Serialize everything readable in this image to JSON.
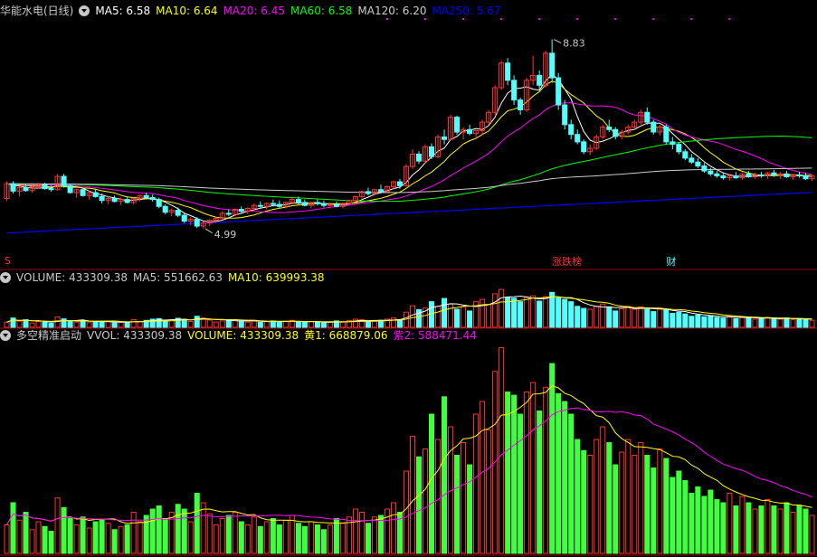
{
  "colors": {
    "up": "#ff3232",
    "down": "#54ffff",
    "ma5": "#ffffff",
    "ma10": "#ffff00",
    "ma20": "#ff00ff",
    "ma60": "#00ff00",
    "ma120": "#cccccc",
    "ma250": "#0000ff",
    "vol_up": "#ff3232",
    "vol_down": "#3fff3f",
    "divider": "#a00000",
    "text": "#c8c8c8"
  },
  "price_panel": {
    "title": "华能水电(日线)",
    "ma_labels": [
      {
        "key": "ma5",
        "text": "MA5: 6.58"
      },
      {
        "key": "ma10",
        "text": "MA10: 6.64"
      },
      {
        "key": "ma20",
        "text": "MA20: 6.45"
      },
      {
        "key": "ma60",
        "text": "MA60: 6.58"
      },
      {
        "key": "ma120",
        "text": "MA120: 6.20"
      },
      {
        "key": "ma250",
        "text": "MA250: 5.67"
      }
    ],
    "high_label": "8.83",
    "low_label": "4.99",
    "markers": [
      {
        "text": "涨跌榜",
        "color": "#ff3232",
        "index": 87
      },
      {
        "text": "财",
        "color": "#54ffff",
        "index": 105
      }
    ],
    "left_marker": "S"
  },
  "volume_panel": {
    "labels": [
      {
        "color": "#c8c8c8",
        "text": "VOLUME: 433309.38"
      },
      {
        "color": "#c8c8c8",
        "text": "MA5: 551662.63"
      },
      {
        "color": "#ffff00",
        "text": "MA10: 639993.38"
      }
    ]
  },
  "indicator_panel": {
    "labels": [
      {
        "color": "#c8c8c8",
        "text": "多空精准启动"
      },
      {
        "color": "#c8c8c8",
        "text": "VVOL: 433309.38"
      },
      {
        "color": "#ffff00",
        "text": "VOLUME: 433309.38"
      },
      {
        "color": "#ffff00",
        "text": "黄1: 668879.06"
      },
      {
        "color": "#ff00ff",
        "text": "紫2: 588471.44"
      }
    ]
  },
  "chart_data": {
    "type": "candlestick",
    "price_range": [
      4.6,
      9.3
    ],
    "ohlc": [
      [
        5.6,
        5.95,
        5.55,
        5.9
      ],
      [
        5.9,
        5.95,
        5.7,
        5.75
      ],
      [
        5.75,
        5.85,
        5.65,
        5.82
      ],
      [
        5.82,
        5.9,
        5.74,
        5.76
      ],
      [
        5.76,
        5.86,
        5.72,
        5.84
      ],
      [
        5.84,
        5.92,
        5.8,
        5.88
      ],
      [
        5.88,
        5.92,
        5.78,
        5.8
      ],
      [
        5.8,
        5.86,
        5.74,
        5.78
      ],
      [
        5.78,
        6.1,
        5.76,
        6.05
      ],
      [
        6.05,
        6.1,
        5.82,
        5.86
      ],
      [
        5.86,
        5.9,
        5.7,
        5.72
      ],
      [
        5.72,
        5.8,
        5.62,
        5.78
      ],
      [
        5.78,
        5.82,
        5.64,
        5.66
      ],
      [
        5.66,
        5.75,
        5.58,
        5.72
      ],
      [
        5.72,
        5.8,
        5.62,
        5.64
      ],
      [
        5.64,
        5.7,
        5.5,
        5.56
      ],
      [
        5.56,
        5.64,
        5.48,
        5.6
      ],
      [
        5.6,
        5.66,
        5.52,
        5.54
      ],
      [
        5.54,
        5.62,
        5.46,
        5.58
      ],
      [
        5.58,
        5.64,
        5.5,
        5.52
      ],
      [
        5.52,
        5.62,
        5.48,
        5.6
      ],
      [
        5.6,
        5.68,
        5.54,
        5.66
      ],
      [
        5.66,
        5.72,
        5.58,
        5.62
      ],
      [
        5.62,
        5.68,
        5.54,
        5.58
      ],
      [
        5.58,
        5.62,
        5.4,
        5.44
      ],
      [
        5.44,
        5.48,
        5.28,
        5.32
      ],
      [
        5.32,
        5.4,
        5.24,
        5.36
      ],
      [
        5.36,
        5.42,
        5.22,
        5.26
      ],
      [
        5.26,
        5.3,
        5.1,
        5.14
      ],
      [
        5.14,
        5.22,
        5.06,
        5.18
      ],
      [
        5.18,
        5.22,
        5.0,
        5.04
      ],
      [
        5.04,
        5.14,
        4.99,
        5.1
      ],
      [
        5.1,
        5.18,
        5.04,
        5.16
      ],
      [
        5.16,
        5.24,
        5.1,
        5.2
      ],
      [
        5.2,
        5.34,
        5.16,
        5.3
      ],
      [
        5.3,
        5.38,
        5.24,
        5.28
      ],
      [
        5.28,
        5.4,
        5.24,
        5.38
      ],
      [
        5.38,
        5.44,
        5.3,
        5.34
      ],
      [
        5.34,
        5.42,
        5.28,
        5.4
      ],
      [
        5.4,
        5.5,
        5.34,
        5.46
      ],
      [
        5.46,
        5.54,
        5.4,
        5.44
      ],
      [
        5.44,
        5.52,
        5.38,
        5.5
      ],
      [
        5.5,
        5.58,
        5.44,
        5.48
      ],
      [
        5.48,
        5.56,
        5.4,
        5.44
      ],
      [
        5.44,
        5.54,
        5.4,
        5.52
      ],
      [
        5.52,
        5.62,
        5.48,
        5.58
      ],
      [
        5.58,
        5.64,
        5.48,
        5.52
      ],
      [
        5.52,
        5.58,
        5.44,
        5.46
      ],
      [
        5.46,
        5.54,
        5.4,
        5.52
      ],
      [
        5.52,
        5.58,
        5.46,
        5.5
      ],
      [
        5.5,
        5.56,
        5.42,
        5.46
      ],
      [
        5.46,
        5.52,
        5.4,
        5.48
      ],
      [
        5.48,
        5.54,
        5.42,
        5.44
      ],
      [
        5.44,
        5.52,
        5.4,
        5.5
      ],
      [
        5.5,
        5.58,
        5.46,
        5.56
      ],
      [
        5.56,
        5.66,
        5.52,
        5.64
      ],
      [
        5.64,
        5.76,
        5.6,
        5.74
      ],
      [
        5.74,
        5.82,
        5.66,
        5.7
      ],
      [
        5.7,
        5.8,
        5.66,
        5.78
      ],
      [
        5.78,
        5.88,
        5.7,
        5.74
      ],
      [
        5.74,
        5.86,
        5.7,
        5.84
      ],
      [
        5.84,
        5.96,
        5.78,
        5.94
      ],
      [
        5.94,
        6.0,
        5.8,
        5.86
      ],
      [
        5.86,
        6.3,
        5.84,
        6.25
      ],
      [
        6.25,
        6.6,
        6.2,
        6.5
      ],
      [
        6.5,
        6.56,
        6.3,
        6.36
      ],
      [
        6.36,
        6.7,
        6.32,
        6.65
      ],
      [
        6.65,
        6.72,
        6.4,
        6.45
      ],
      [
        6.45,
        6.9,
        6.42,
        6.85
      ],
      [
        6.85,
        7.0,
        6.7,
        6.8
      ],
      [
        6.8,
        7.3,
        6.78,
        7.25
      ],
      [
        7.25,
        7.28,
        6.9,
        6.95
      ],
      [
        6.95,
        7.05,
        6.8,
        7.0
      ],
      [
        7.0,
        7.1,
        6.88,
        6.92
      ],
      [
        6.92,
        7.0,
        6.8,
        6.98
      ],
      [
        6.98,
        7.2,
        6.9,
        7.15
      ],
      [
        7.15,
        7.4,
        7.1,
        7.35
      ],
      [
        7.35,
        7.9,
        7.3,
        7.85
      ],
      [
        7.85,
        8.4,
        7.8,
        8.35
      ],
      [
        8.35,
        8.45,
        7.9,
        8.0
      ],
      [
        8.0,
        8.1,
        7.5,
        7.6
      ],
      [
        7.6,
        7.65,
        7.3,
        7.4
      ],
      [
        7.4,
        8.05,
        7.36,
        8.0
      ],
      [
        8.0,
        8.5,
        7.9,
        8.1
      ],
      [
        8.1,
        8.2,
        7.8,
        7.9
      ],
      [
        7.9,
        8.6,
        7.85,
        8.55
      ],
      [
        8.55,
        8.83,
        7.95,
        8.05
      ],
      [
        8.05,
        8.15,
        7.4,
        7.5
      ],
      [
        7.5,
        7.6,
        7.0,
        7.1
      ],
      [
        7.1,
        7.2,
        6.8,
        6.9
      ],
      [
        6.9,
        7.0,
        6.7,
        6.75
      ],
      [
        6.75,
        6.8,
        6.5,
        6.55
      ],
      [
        6.55,
        6.7,
        6.48,
        6.62
      ],
      [
        6.62,
        6.9,
        6.58,
        6.85
      ],
      [
        6.85,
        7.1,
        6.8,
        7.05
      ],
      [
        7.05,
        7.2,
        6.95,
        7.0
      ],
      [
        7.0,
        7.05,
        6.8,
        6.86
      ],
      [
        6.86,
        7.0,
        6.8,
        6.95
      ],
      [
        6.95,
        7.1,
        6.9,
        7.05
      ],
      [
        7.05,
        7.2,
        7.0,
        7.15
      ],
      [
        7.15,
        7.4,
        7.1,
        7.35
      ],
      [
        7.35,
        7.45,
        7.1,
        7.15
      ],
      [
        7.15,
        7.2,
        6.9,
        6.95
      ],
      [
        6.95,
        7.1,
        6.88,
        7.05
      ],
      [
        7.05,
        7.1,
        6.7,
        6.75
      ],
      [
        6.75,
        6.85,
        6.6,
        6.7
      ],
      [
        6.7,
        6.75,
        6.5,
        6.55
      ],
      [
        6.55,
        6.6,
        6.38,
        6.42
      ],
      [
        6.42,
        6.5,
        6.3,
        6.34
      ],
      [
        6.34,
        6.42,
        6.22,
        6.26
      ],
      [
        6.26,
        6.32,
        6.12,
        6.16
      ],
      [
        6.16,
        6.22,
        6.06,
        6.1
      ],
      [
        6.1,
        6.16,
        6.02,
        6.06
      ],
      [
        6.06,
        6.12,
        5.98,
        6.02
      ],
      [
        6.02,
        6.1,
        5.96,
        6.06
      ],
      [
        6.06,
        6.14,
        6.0,
        6.02
      ],
      [
        6.02,
        6.12,
        5.98,
        6.1
      ],
      [
        6.1,
        6.16,
        6.02,
        6.04
      ],
      [
        6.04,
        6.12,
        6.0,
        6.08
      ],
      [
        6.08,
        6.14,
        6.02,
        6.06
      ],
      [
        6.06,
        6.14,
        6.0,
        6.12
      ],
      [
        6.12,
        6.18,
        6.04,
        6.08
      ],
      [
        6.08,
        6.14,
        6.0,
        6.1
      ],
      [
        6.1,
        6.16,
        6.02,
        6.04
      ],
      [
        6.04,
        6.1,
        5.98,
        6.08
      ],
      [
        6.08,
        6.14,
        6.02,
        6.06
      ],
      [
        6.06,
        6.12,
        5.98,
        6.0
      ],
      [
        6.0,
        6.08,
        5.96,
        6.06
      ]
    ],
    "volume": [
      180,
      320,
      210,
      260,
      150,
      200,
      170,
      140,
      350,
      290,
      220,
      180,
      230,
      160,
      200,
      210,
      190,
      150,
      170,
      180,
      260,
      200,
      240,
      280,
      300,
      220,
      260,
      310,
      280,
      200,
      380,
      320,
      250,
      180,
      220,
      240,
      260,
      200,
      180,
      230,
      170,
      200,
      220,
      180,
      210,
      240,
      190,
      170,
      200,
      180,
      150,
      180,
      220,
      190,
      230,
      280,
      260,
      190,
      230,
      240,
      280,
      320,
      260,
      520,
      740,
      610,
      660,
      880,
      720,
      990,
      800,
      620,
      700,
      560,
      880,
      960,
      780,
      1150,
      1300,
      1020,
      1000,
      880,
      1020,
      1080,
      900,
      1050,
      1200,
      1010,
      960,
      880,
      720,
      650,
      620,
      720,
      800,
      700,
      560,
      640,
      720,
      620,
      700,
      620,
      540,
      660,
      600,
      480,
      520,
      460,
      380,
      420,
      360,
      400,
      340,
      320,
      380,
      300,
      360,
      320,
      280,
      300,
      340,
      300,
      280,
      320,
      260,
      300,
      280,
      240
    ],
    "indicator": {
      "yellow_range": [
        0,
        1400
      ],
      "purple_range": [
        0,
        1400
      ]
    }
  }
}
